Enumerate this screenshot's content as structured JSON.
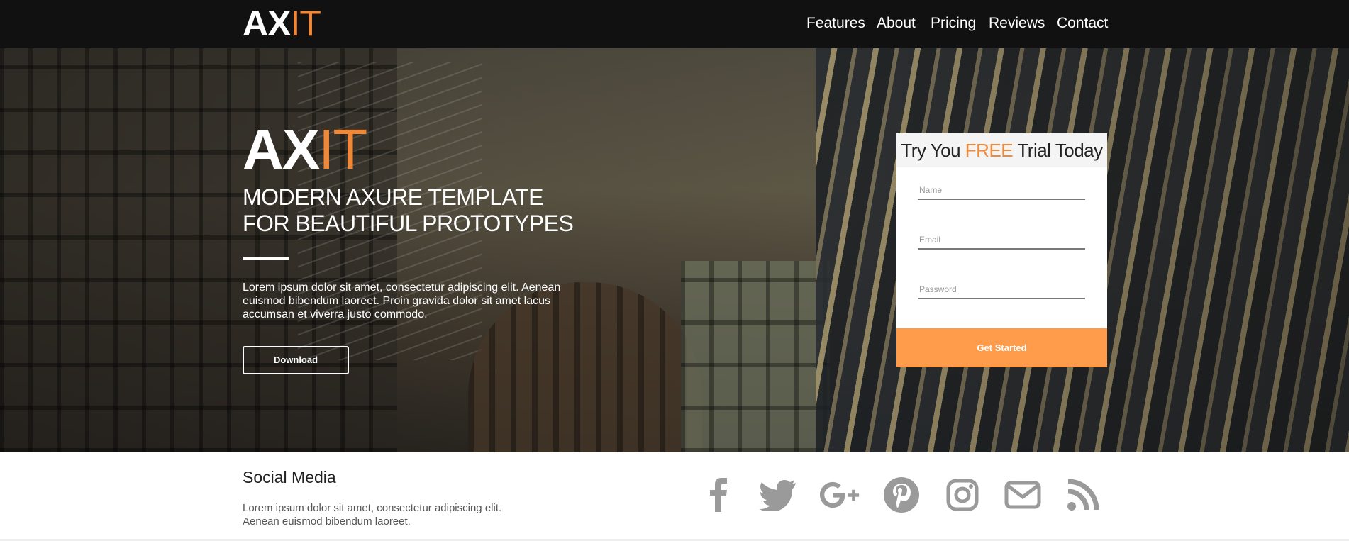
{
  "nav": {
    "logo": {
      "ax": "AX",
      "it": "IT"
    },
    "items": [
      {
        "label": "Features"
      },
      {
        "label": "About"
      },
      {
        "label": "Pricing"
      },
      {
        "label": "Reviews"
      },
      {
        "label": "Contact"
      }
    ]
  },
  "hero": {
    "logo": {
      "ax": "AX",
      "it": "IT"
    },
    "title_line1": "MODERN AXURE TEMPLATE",
    "title_line2": "FOR BEAUTIFUL PROTOTYPES",
    "text": "Lorem ipsum dolor sit amet, consectetur adipiscing elit. Aenean euismod bibendum laoreet. Proin gravida dolor sit amet lacus accumsan et viverra justo commodo.",
    "download_label": "Download"
  },
  "signup": {
    "heading_pre": "Try You ",
    "heading_free": "FREE",
    "heading_post": " Trial Today",
    "name_placeholder": "Name",
    "email_placeholder": "Email",
    "password_placeholder": "Password",
    "submit_label": "Get Started"
  },
  "social": {
    "title": "Social Media",
    "text_line1": "Lorem ipsum dolor sit amet, consectetur adipiscing elit.",
    "text_line2": "Aenean euismod bibendum laoreet.",
    "icons": [
      "facebook-icon",
      "twitter-icon",
      "google-plus-icon",
      "pinterest-icon",
      "instagram-icon",
      "email-icon",
      "rss-icon"
    ]
  },
  "colors": {
    "accent": "#f0883a",
    "button": "#ff9c4b",
    "topbar": "#111111",
    "icon_gray": "#9a9a9a"
  }
}
